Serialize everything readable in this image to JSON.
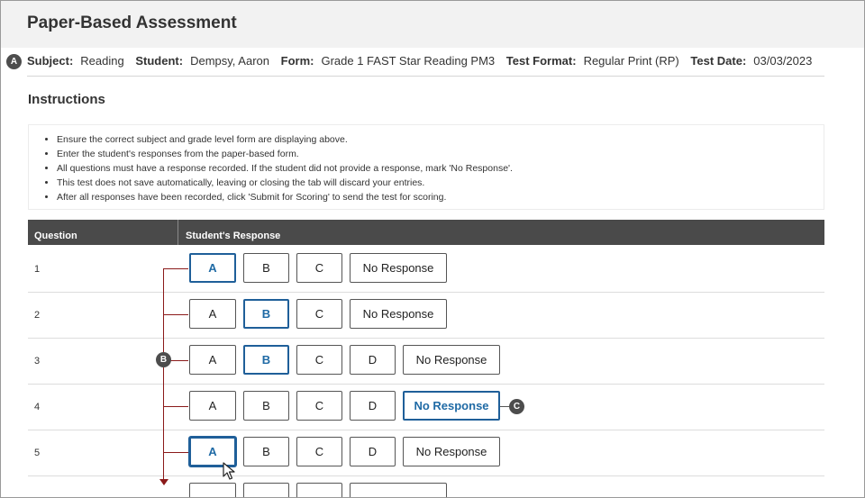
{
  "header": {
    "title": "Paper-Based Assessment"
  },
  "badges": {
    "a": "A",
    "b": "B",
    "c": "C"
  },
  "info": {
    "subject_label": "Subject:",
    "subject_value": "Reading",
    "student_label": "Student:",
    "student_value": "Dempsy, Aaron",
    "form_label": "Form:",
    "form_value": "Grade 1 FAST Star Reading PM3",
    "format_label": "Test Format:",
    "format_value": "Regular Print (RP)",
    "date_label": "Test Date:",
    "date_value": "03/03/2023"
  },
  "instructions": {
    "title": "Instructions",
    "items": [
      "Ensure the correct subject and grade level form are displaying above.",
      "Enter the student's responses from the paper-based form.",
      "All questions must have a response recorded. If the student did not provide a response, mark 'No Response'.",
      "This test does not save automatically, leaving or closing the tab will discard your entries.",
      "After all responses have been recorded, click 'Submit for Scoring' to send the test for scoring."
    ]
  },
  "table": {
    "col_question": "Question",
    "col_response": "Student's Response",
    "rows": [
      {
        "q": "1",
        "options": [
          "A",
          "B",
          "C",
          "No Response"
        ],
        "selected": "A"
      },
      {
        "q": "2",
        "options": [
          "A",
          "B",
          "C",
          "No Response"
        ],
        "selected": "B"
      },
      {
        "q": "3",
        "options": [
          "A",
          "B",
          "C",
          "D",
          "No Response"
        ],
        "selected": "B"
      },
      {
        "q": "4",
        "options": [
          "A",
          "B",
          "C",
          "D",
          "No Response"
        ],
        "selected": "No Response"
      },
      {
        "q": "5",
        "options": [
          "A",
          "B",
          "C",
          "D",
          "No Response"
        ],
        "selected": "A"
      }
    ]
  },
  "colors": {
    "accent": "#1f5f99",
    "header_bg": "#f2f2f2",
    "table_head": "#4a4a4a",
    "bracket": "#8b1a1a"
  }
}
